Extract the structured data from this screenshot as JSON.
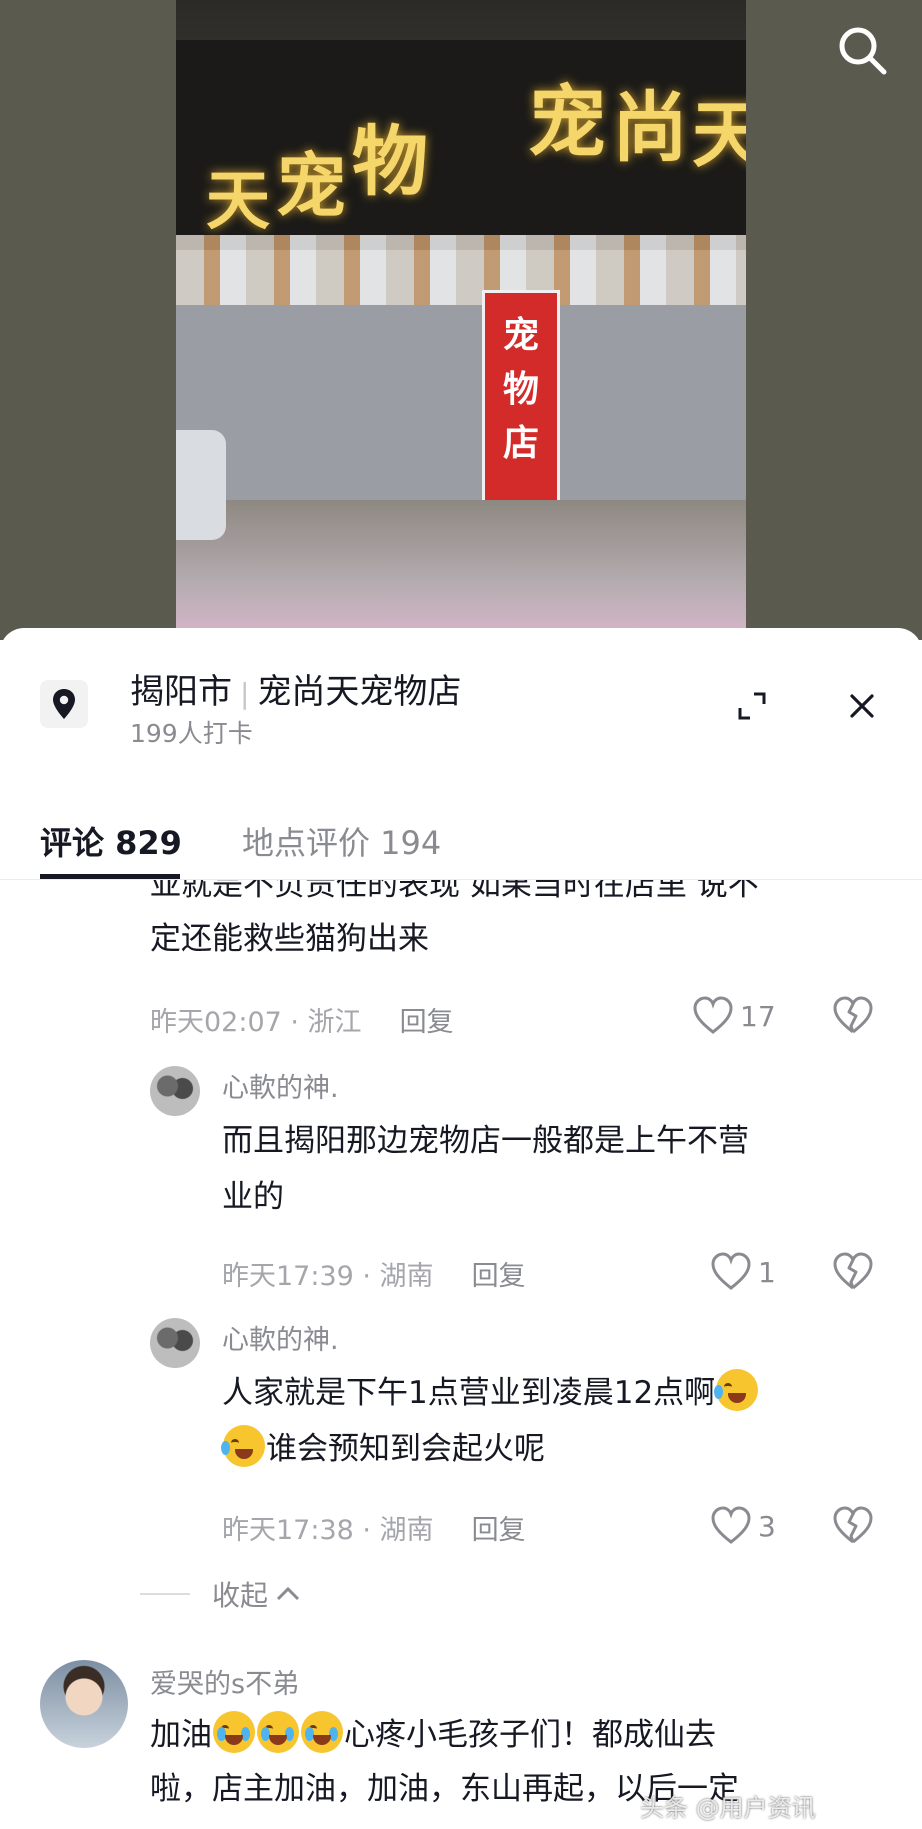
{
  "video": {
    "sign_chars_left": [
      "天",
      "宠",
      "物"
    ],
    "sign_chars_right": [
      "宠",
      "尚",
      "天"
    ],
    "banner_chars": [
      "宠",
      "物",
      "店"
    ]
  },
  "location": {
    "city": "揭阳市",
    "shop_name": "宠尚天宠物店",
    "checkins": "199人打卡"
  },
  "tabs": [
    {
      "label": "评论 829",
      "active": true
    },
    {
      "label": "地点评价 194",
      "active": false
    }
  ],
  "comments": {
    "partial": {
      "line1": "亚就是不负责任的表现 如果当时在店里 说不",
      "line2": "定还能救些猫狗出来",
      "time": "昨天02:07 · 浙江",
      "reply": "回复",
      "likes": "17"
    },
    "replies": [
      {
        "user": "心軟的神.",
        "line1": "而且揭阳那边宠物店一般都是上午不营",
        "line2": "业的",
        "time": "昨天17:39 · 湖南",
        "reply": "回复",
        "likes": "1"
      },
      {
        "user": "心軟的神.",
        "line1": "人家就是下午1点营业到凌晨12点啊",
        "line2": "谁会预知到会起火呢",
        "time": "昨天17:38 · 湖南",
        "reply": "回复",
        "likes": "3"
      }
    ],
    "collapse": "收起",
    "last": {
      "user": "爱哭的s不弟",
      "line1_a": "加油",
      "line1_b": "心疼小毛孩子们！都成仙去",
      "line2": "啦，店主加油，加油，东山再起，以后一定"
    }
  },
  "watermark": "头条 @用户资讯"
}
